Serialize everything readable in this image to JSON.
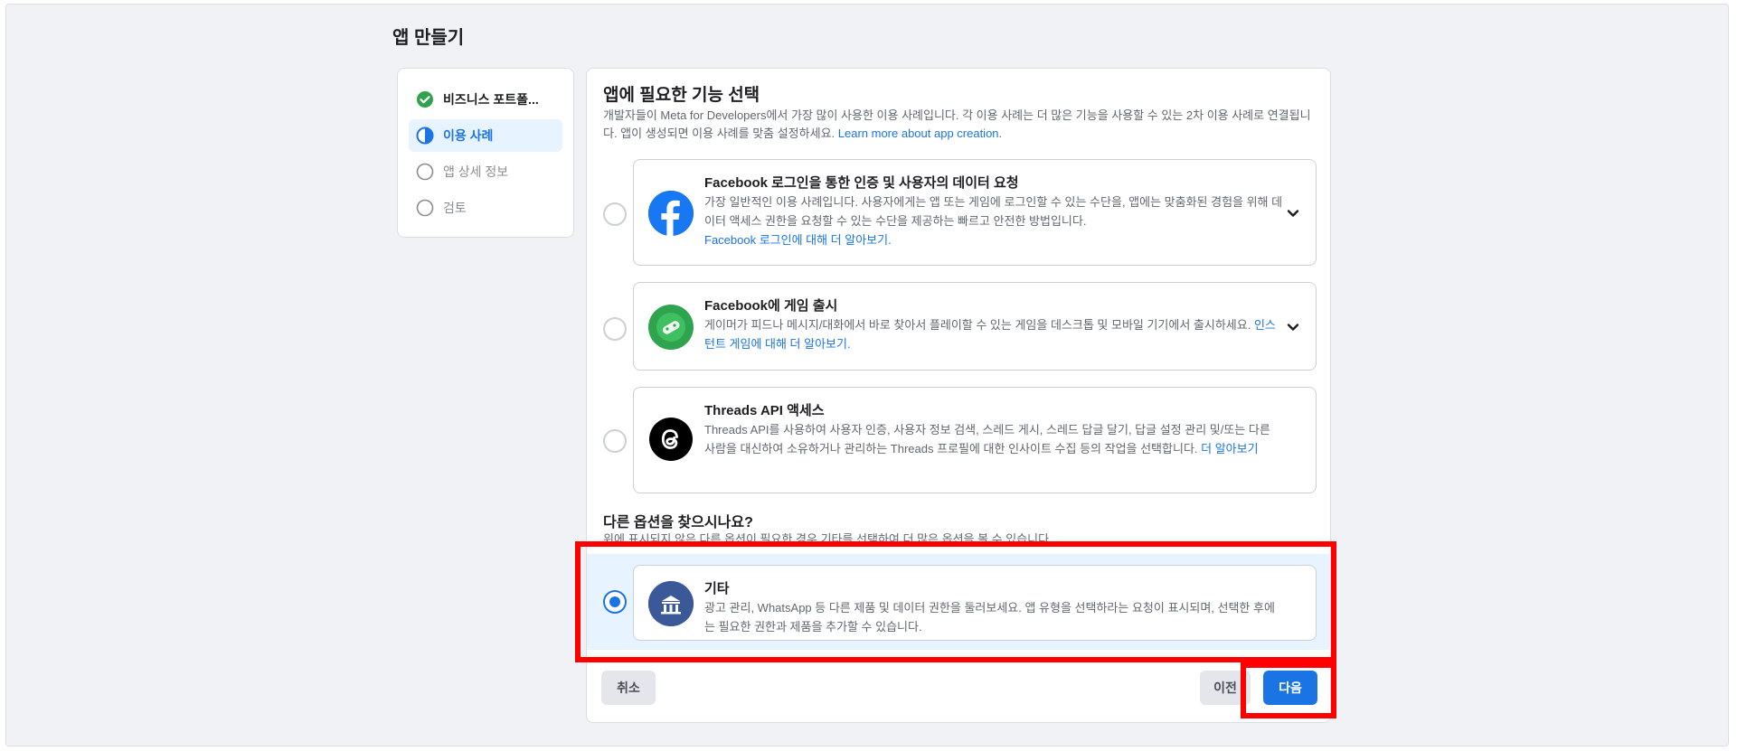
{
  "page_title": "앱 만들기",
  "steps": [
    {
      "label": "비즈니스 포트폴...",
      "state": "done",
      "icon": "check-circle-icon"
    },
    {
      "label": "이용 사례",
      "state": "active",
      "icon": "half-circle-icon"
    },
    {
      "label": "앱 상세 정보",
      "state": "todo",
      "icon": "empty-circle-icon"
    },
    {
      "label": "검토",
      "state": "todo",
      "icon": "empty-circle-icon"
    }
  ],
  "main": {
    "heading": "앱에 필요한 기능 선택",
    "lead_text": "개발자들이 Meta for Developers에서 가장 많이 사용한 이용 사례입니다. 각 이용 사례는 더 많은 기능을 사용할 수 있는 2차 이용 사례로 연결됩니다. 앱이 생성되면 이용 사례를 맞춤 설정하세요. ",
    "lead_link": "Learn more about app creation."
  },
  "options": [
    {
      "title": "Facebook 로그인을 통한 인증 및 사용자의 데이터 요청",
      "desc": "가장 일반적인 이용 사례입니다. 사용자에게는 앱 또는 게임에 로그인할 수 있는 수단을, 앱에는 맞춤화된 경험을 위해 데이터 액세스 권한을 요청할 수 있는 수단을 제공하는 빠르고 안전한 방법입니다.",
      "link": "Facebook 로그인에 대해 더 알아보기.",
      "icon": "facebook-logo-icon"
    },
    {
      "title": "Facebook에 게임 출시",
      "desc": "게이머가 피드나 메시지/대화에서 바로 찾아서 플레이할 수 있는 게임을 데스크톱 및 모바일 기기에서 출시하세요. ",
      "link": "인스턴트 게임에 대해 더 알아보기.",
      "icon": "game-controller-icon"
    },
    {
      "title": "Threads API 액세스",
      "desc": "Threads API를 사용하여 사용자 인증, 사용자 정보 검색, 스레드 게시, 스레드 답글 달기, 답글 설정 관리 및/또는 다른 사람을 대신하여 소유하거나 관리하는 Threads 프로필에 대한 인사이트 수집 등의 작업을 선택합니다. ",
      "link": "더 알아보기",
      "icon": "threads-logo-icon"
    }
  ],
  "other": {
    "heading": "다른 옵션을 찾으시나요?",
    "desc": "위에 표시되지 않은 다른 옵션이 필요한 경우 기타를 선택하여 더 많은 옵션을 볼 수 있습니다.",
    "option_title": "기타",
    "option_desc": "광고 관리, WhatsApp 등 다른 제품 및 데이터 권한을 둘러보세요. 앱 유형을 선택하라는 요청이 표시되며, 선택한 후에는 필요한 권한과 제품을 추가할 수 있습니다.",
    "icon": "building-icon"
  },
  "buttons": {
    "cancel": "취소",
    "prev": "이전",
    "next": "다음"
  },
  "colors": {
    "accent": "#1b74e4",
    "highlight": "#ff0000",
    "selected_bg": "#e7f3ff"
  }
}
